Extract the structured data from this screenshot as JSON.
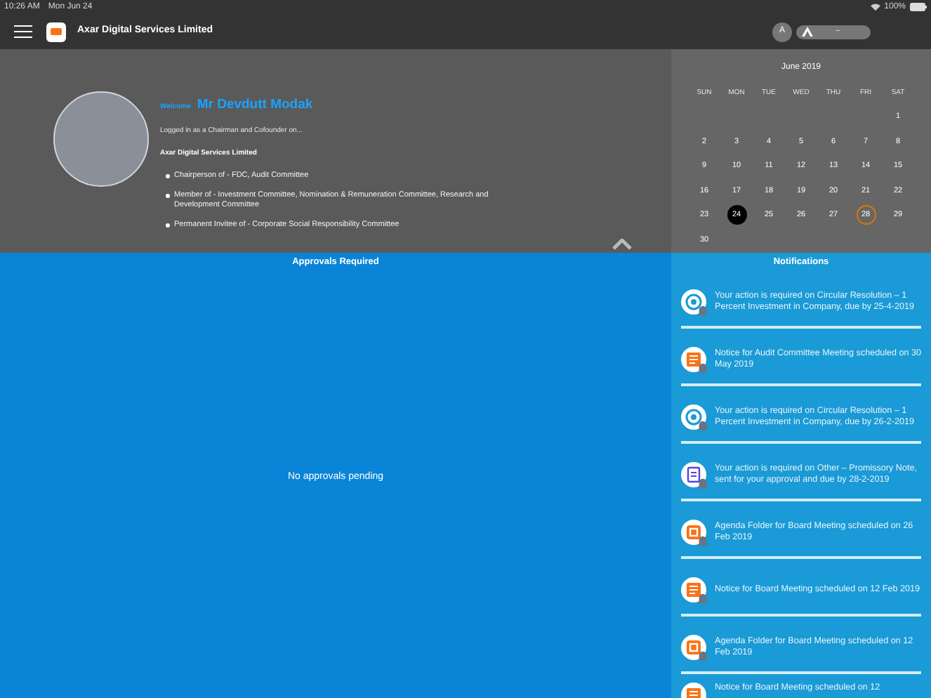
{
  "status_bar": {
    "time": "10:26 AM",
    "date": "Mon Jun 24",
    "battery": "100%"
  },
  "header": {
    "title": "Axar Digital Services Limited",
    "avatar": "A",
    "switcher_text": "--"
  },
  "profile": {
    "welcome": "Welcome",
    "name": "Mr Devdutt Modak",
    "logged_in": "Logged in as a Chairman and Cofounder on...",
    "company": "Axar Digital Services Limited",
    "roles": [
      "Chairperson of - FDC, Audit Committee",
      "Member of - Investment Committee, Nomination & Remuneration Committee, Research and Development Committee",
      "Permanent Invitee of - Corporate Social Responsibility Committee"
    ]
  },
  "calendar": {
    "month": "June 2019",
    "weekdays": [
      "SUN",
      "MON",
      "TUE",
      "WED",
      "THU",
      "FRI",
      "SAT"
    ],
    "weeks": [
      [
        {
          "day": "1",
          "selected": false,
          "circled": false
        }
      ],
      [
        {
          "day": "2",
          "selected": false,
          "circled": false
        },
        {
          "day": "3",
          "selected": false,
          "circled": false
        },
        {
          "day": "4",
          "selected": false,
          "circled": false
        },
        {
          "day": "5",
          "selected": false,
          "circled": false
        },
        {
          "day": "6",
          "selected": false,
          "circled": false
        },
        {
          "day": "7",
          "selected": false,
          "circled": false
        },
        {
          "day": "8",
          "selected": false,
          "circled": false
        }
      ],
      [
        {
          "day": "9",
          "selected": false,
          "circled": false
        },
        {
          "day": "10",
          "selected": false,
          "circled": false
        },
        {
          "day": "11",
          "selected": false,
          "circled": false
        },
        {
          "day": "12",
          "selected": false,
          "circled": false
        },
        {
          "day": "13",
          "selected": false,
          "circled": false
        },
        {
          "day": "14",
          "selected": false,
          "circled": false
        },
        {
          "day": "15",
          "selected": false,
          "circled": false
        }
      ],
      [
        {
          "day": "16",
          "selected": false,
          "circled": false
        },
        {
          "day": "17",
          "selected": false,
          "circled": false
        },
        {
          "day": "18",
          "selected": false,
          "circled": false
        },
        {
          "day": "19",
          "selected": false,
          "circled": false
        },
        {
          "day": "20",
          "selected": false,
          "circled": false
        },
        {
          "day": "21",
          "selected": false,
          "circled": false
        },
        {
          "day": "22",
          "selected": false,
          "circled": false
        }
      ],
      [
        {
          "day": "23",
          "selected": false,
          "circled": false
        },
        {
          "day": "24",
          "selected": true,
          "circled": false
        },
        {
          "day": "25",
          "selected": false,
          "circled": false
        },
        {
          "day": "26",
          "selected": false,
          "circled": false
        },
        {
          "day": "27",
          "selected": false,
          "circled": false
        },
        {
          "day": "28",
          "selected": false,
          "circled": true
        },
        {
          "day": "29",
          "selected": false,
          "circled": false
        }
      ],
      [
        {
          "day": "30",
          "selected": false,
          "circled": false
        }
      ]
    ]
  },
  "approvals": {
    "title": "Approvals Required",
    "empty_text": "No approvals pending"
  },
  "notifications": {
    "title": "Notifications",
    "items": [
      {
        "kind": "resolution",
        "text": "Your action is required on Circular Resolution – 1 Percent Investment in Company, due by 25-4-2019"
      },
      {
        "kind": "notice",
        "text": "Notice for Audit Committee Meeting  scheduled on 30 May 2019"
      },
      {
        "kind": "resolution",
        "text": "Your action is required on Circular Resolution – 1 Percent Investment in Company, due by 26-2-2019"
      },
      {
        "kind": "other",
        "text": "Your action is required on Other – Promissory Note, sent for your approval and due by 28-2-2019"
      },
      {
        "kind": "agenda",
        "text": "Agenda Folder for Board Meeting  scheduled on 26 Feb 2019"
      },
      {
        "kind": "notice",
        "text": "Notice for Board Meeting  scheduled on 12 Feb 2019"
      },
      {
        "kind": "agenda",
        "text": "Agenda Folder for Board Meeting  scheduled on 12 Feb 2019"
      },
      {
        "kind": "notice",
        "text": "Notice for Board Meeting  scheduled on 12"
      }
    ]
  }
}
